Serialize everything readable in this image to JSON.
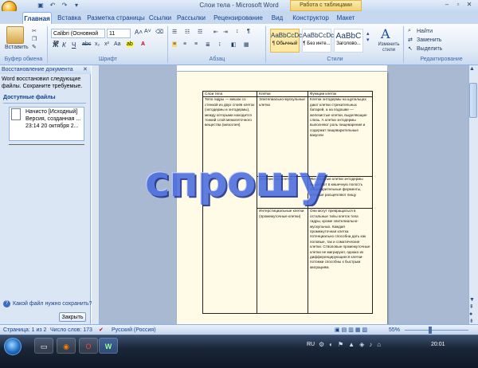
{
  "window": {
    "title": "Слои тела - Microsoft Word",
    "context_tab": "Работа с таблицами"
  },
  "tabs": [
    "Главная",
    "Вставка",
    "Разметка страницы",
    "Ссылки",
    "Рассылки",
    "Рецензирование",
    "Вид",
    "Конструктор",
    "Макет"
  ],
  "ribbon": {
    "clipboard": {
      "paste": "Вставить",
      "label": "Буфер обмена"
    },
    "font": {
      "name": "Calibri (Основной те",
      "size": "11",
      "label": "Шрифт"
    },
    "paragraph": {
      "label": "Абзац"
    },
    "styles": {
      "items": [
        {
          "preview": "AaBbCcDc",
          "name": "¶ Обычный"
        },
        {
          "preview": "AaBbCcDc",
          "name": "¶ Без инте..."
        },
        {
          "preview": "AaBbC",
          "name": "Заголово..."
        }
      ],
      "change": "Изменить стили",
      "label": "Стили"
    },
    "editing": {
      "find": "Найти",
      "replace": "Заменить",
      "select": "Выделить",
      "label": "Редактирование"
    }
  },
  "recovery": {
    "header": "Восстановление документа",
    "message": "Word восстановил следующие файлы. Сохраните требуемые.",
    "files_header": "Доступные файлы",
    "file": {
      "line1": "Начисто [Исходный]",
      "line2": "Версия, созданная ...",
      "line3": "23:14 20 октября 2..."
    },
    "help": "Какой файл нужно сохранить?",
    "close": "Закрыть"
  },
  "document": {
    "table": {
      "headers": [
        "Слои тела",
        "Клетки",
        "Функции клеток"
      ],
      "row1": {
        "c1": "Тело гидры — мешок со стенкой из двух слоёв клеток (эктодермы и энтодермы), между которыми находится тонкий слой межклеточного вещества (мезоглея)",
        "c2": "Эпителиально-мускульные клетки",
        "c3": "Клетки энтодермы на щупальцах дают клетки стрекательных батарей, а на подошве — железистые клетки, выделяющие слизь. А клетки энтодермы выполняют роль пищеварения и содержат пищеварительные вакуоли"
      },
      "row2": {
        "c2": "Железистые клетки",
        "c3": "Железистые клетки энтодермы выделяют в кишечную полость пищеварительные ферменты, которые расщепляют пищу"
      },
      "row3": {
        "c2": "Интерстициальные клетки (промежуточные клетки)",
        "c3": "Они могут превращаться в остальные типы клеток тела гидры, кроме эпителиально-мускульных. Каждая промежуточная клетка потенциально способна дать как половые, так и соматические клетки. Стволовые промежуточные клетки не мигрируют, однако их дифференцирующиеся клетки-потомки способны к быстрым миграциям."
      }
    }
  },
  "watermark": "спрошу",
  "statusbar": {
    "page": "Страница: 1 из 2",
    "words": "Число слов: 173",
    "lang": "Русский (Россия)",
    "zoom": "55%"
  },
  "taskbar": {
    "lang": "RU",
    "time": "20:01"
  }
}
